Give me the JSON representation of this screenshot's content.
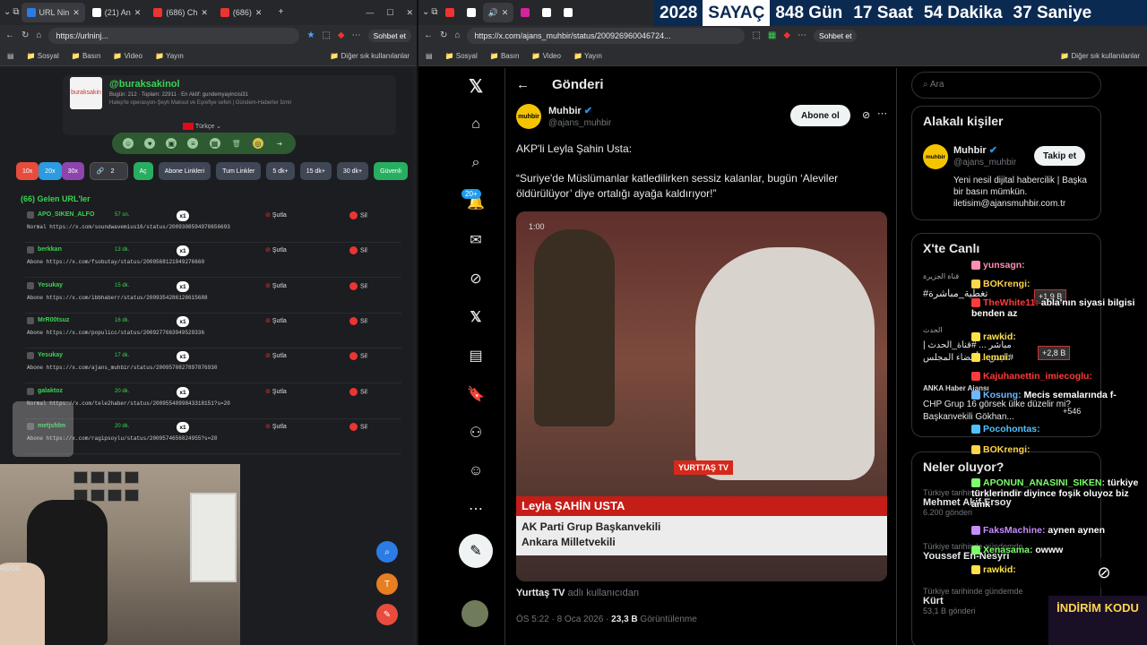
{
  "left_browser": {
    "tabs": [
      "URL Nin",
      "(21) An",
      "(686) Ch",
      "(686)"
    ],
    "url": "https://urlninj...",
    "bookmarks": [
      "Sosyal",
      "Basın",
      "Video",
      "Yayın"
    ],
    "other_bookmarks": "Diğer sık kullanılanlar",
    "sohbet": "Sohbet et"
  },
  "left_page": {
    "profile": {
      "logo": "buraksakin",
      "name": "@buraksakinol",
      "stats": "Bugün: 212  ·  Toplam: 22911  ·  En Aktif: gundemyayincisi31",
      "desc": "Halep'te operasyon-Şeyh Maksut ve Eşrefiye seferi | Gündem-Haberler İzmir",
      "lang": "Türkçe"
    },
    "buttons": [
      "10x",
      "20x",
      "30x",
      "2",
      "Aç",
      "Abone Linkleri",
      "Tum Linkler",
      "5 dk+",
      "15 dk+",
      "30 dk+",
      "Güvenli"
    ],
    "heading": "(66) Gelen URL'ler",
    "rows": [
      {
        "user": "APO_SIKEN_ALFO",
        "time": "57 sn.",
        "x": "x1",
        "kind": "Normal",
        "link": "https://x.com/soundwavemius16/status/2009308594978656693"
      },
      {
        "user": "berkkan",
        "time": "13 dk.",
        "x": "x1",
        "kind": "Abone",
        "link": "https://x.com/fsobutay/status/2009568121049276660"
      },
      {
        "user": "Yesukay",
        "time": "15 dk.",
        "x": "x1",
        "kind": "Abone",
        "link": "https://x.com/ibbhaberr/status/2009354286128615688"
      },
      {
        "user": "MrR00tsuz",
        "time": "16 dk.",
        "x": "x1",
        "kind": "Abone",
        "link": "https://x.com/populicc/status/2009277663949529336"
      },
      {
        "user": "Yesukay",
        "time": "17 dk.",
        "x": "x1",
        "kind": "Abone",
        "link": "https://x.com/ajans_muhbir/status/2009570827897876930"
      },
      {
        "user": "galaktoz",
        "time": "20 dk.",
        "x": "x1",
        "kind": "Normal",
        "link": "https://x.com/tele2haber/status/2009554099843318151?s=20"
      },
      {
        "user": "metjsfdm",
        "time": "20 dk.",
        "x": "x1",
        "kind": "Abone",
        "link": "https://x.com/ragipsoylu/status/2009574656824955?s=20"
      }
    ],
    "action_shutla": "Şutla",
    "action_sil": "Sil",
    "webcam_text": "RODE"
  },
  "right_browser": {
    "url": "https://x.com/ajans_muhbir/status/200926960046724...",
    "bookmarks": [
      "Sosyal",
      "Basın",
      "Video",
      "Yayın"
    ],
    "other_bookmarks": "Diğer sık kullanılanlar",
    "sohbet": "Sohbet et"
  },
  "counter": {
    "year": "2028",
    "label": "SAYAÇ",
    "days": "848 Gün",
    "hours": "17 Saat",
    "minutes": "54 Dakika",
    "seconds": "37 Saniye"
  },
  "x_post": {
    "header": "Gönderi",
    "author": "Muhbir",
    "handle": "@ajans_muhbir",
    "follow_btn": "Abone ol",
    "line1": "AKP'li Leyla Şahin Usta:",
    "line2": "“Suriye'de Müslümanlar katledilirken sessiz kalanlar, bugün ‘Aleviler öldürülüyor’ diye ortalığı ayağa kaldırıyor!”",
    "video_name": "Leyla ŞAHİN USTA",
    "video_title1": "AK Parti Grup Başkanvekili",
    "video_title2": "Ankara Milletvekili",
    "video_logo": "YURTTAŞ TV",
    "video_time": "1:00",
    "source_user": "Yurttaş TV",
    "source_suffix": "adlı kullanıcıdan",
    "meta_time": "ÖS 5:22 · 8 Oca 2026 · ",
    "views": "23,3 B",
    "views_label": "Görüntülenme",
    "notif_badge": "20+"
  },
  "x_sidebar": {
    "search_placeholder": "Ara",
    "related_title": "Alakalı kişiler",
    "related_name": "Muhbir",
    "related_handle": "@ajans_muhbir",
    "related_btn": "Takip et",
    "related_bio": "Yeni nesil dijital habercilik | Başka bir basın mümkün. iletisim@ajansmuhbir.com.tr",
    "live_title": "X'te Canlı",
    "live1_tag": "قناة الجزيرة",
    "live1_text": "#تغطية_مباشرة",
    "live2_tag": "الحدث",
    "live2_text": "مباشر ... #قناة_الحدث | #اليمن... أعضاء المجلس",
    "live3_tag": "ANKA Haber Ajansı",
    "live3_text": "CHP Grup 16 görsek ülke düzelir mi? Başkanvekili Gökhan...",
    "plus1": "+1,9 B",
    "plus2": "+2,8 B",
    "plus3": "+546",
    "news_title": "Neler oluyor?",
    "trend_ctx": "Türkiye tarihinde gündemde",
    "trends": [
      {
        "name": "Mehmet Akif Ersoy",
        "count": "6.200 gönderi"
      },
      {
        "name": "Youssef En-Nesyri",
        "count": ""
      },
      {
        "name": "Kürt",
        "count": "53,1 B gönderi"
      }
    ]
  },
  "chat": [
    {
      "user": "yunsagn:",
      "msg": "",
      "color": "#ff8fb0"
    },
    {
      "user": "BOKrengi:",
      "msg": "",
      "color": "#ffd54a"
    },
    {
      "user": "TheWhite11:",
      "msg": "abla'nın siyasi bilgisi benden az",
      "color": "#ff3b3b"
    },
    {
      "user": "rawkid:",
      "msg": "",
      "color": "#ffe14a"
    },
    {
      "user": "lemni:",
      "msg": "",
      "color": "#ffe14a"
    },
    {
      "user": "Kajuhanettin_imiecoglu:",
      "msg": "",
      "color": "#ff3b3b"
    },
    {
      "user": "Kosung:",
      "msg": "Mecis semalarında f-",
      "color": "#6fb7ff"
    },
    {
      "user": "Pocohontas:",
      "msg": "",
      "color": "#4fc3ff"
    },
    {
      "user": "BOKrengi:",
      "msg": "",
      "color": "#ffd54a"
    },
    {
      "user": "APONUN_ANASINI_SIKEN:",
      "msg": "türkiye türklerindir diyince foşik oluyoz biz amk",
      "color": "#7cff6b"
    },
    {
      "user": "FaksMachine:",
      "msg": "aynen aynen",
      "color": "#c98bff"
    },
    {
      "user": "Xenasama:",
      "msg": "owww",
      "color": "#7cff6b"
    },
    {
      "user": "rawkid:",
      "msg": "",
      "color": "#ffe14a"
    }
  ],
  "indirim": "İNDİRİM KODU"
}
